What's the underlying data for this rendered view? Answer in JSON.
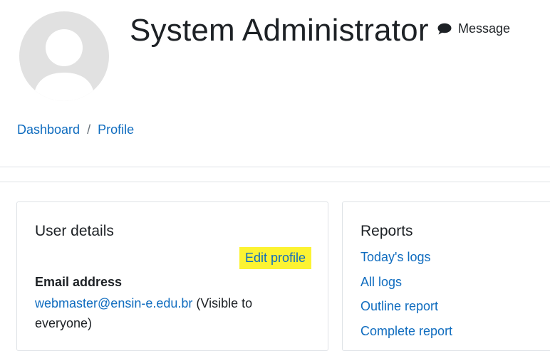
{
  "profile": {
    "name": "System Administrator",
    "message_label": "Message"
  },
  "breadcrumb": {
    "items": [
      "Dashboard",
      "Profile"
    ],
    "separator": "/"
  },
  "user_details": {
    "title": "User details",
    "edit_profile_label": "Edit profile",
    "email_label": "Email address",
    "email_value": "webmaster@ensin-e.edu.br",
    "email_visibility": "(Visible to everyone)"
  },
  "reports": {
    "title": "Reports",
    "links": [
      "Today's logs",
      "All logs",
      "Outline report",
      "Complete report"
    ]
  },
  "colors": {
    "link": "#0f6cbf",
    "text": "#1d2125",
    "highlight": "#fcf332",
    "avatar_bg": "#e1e1e1",
    "border": "#dee2e6"
  },
  "icons": {
    "avatar": "default-user-avatar",
    "message": "speech-bubble-icon"
  }
}
